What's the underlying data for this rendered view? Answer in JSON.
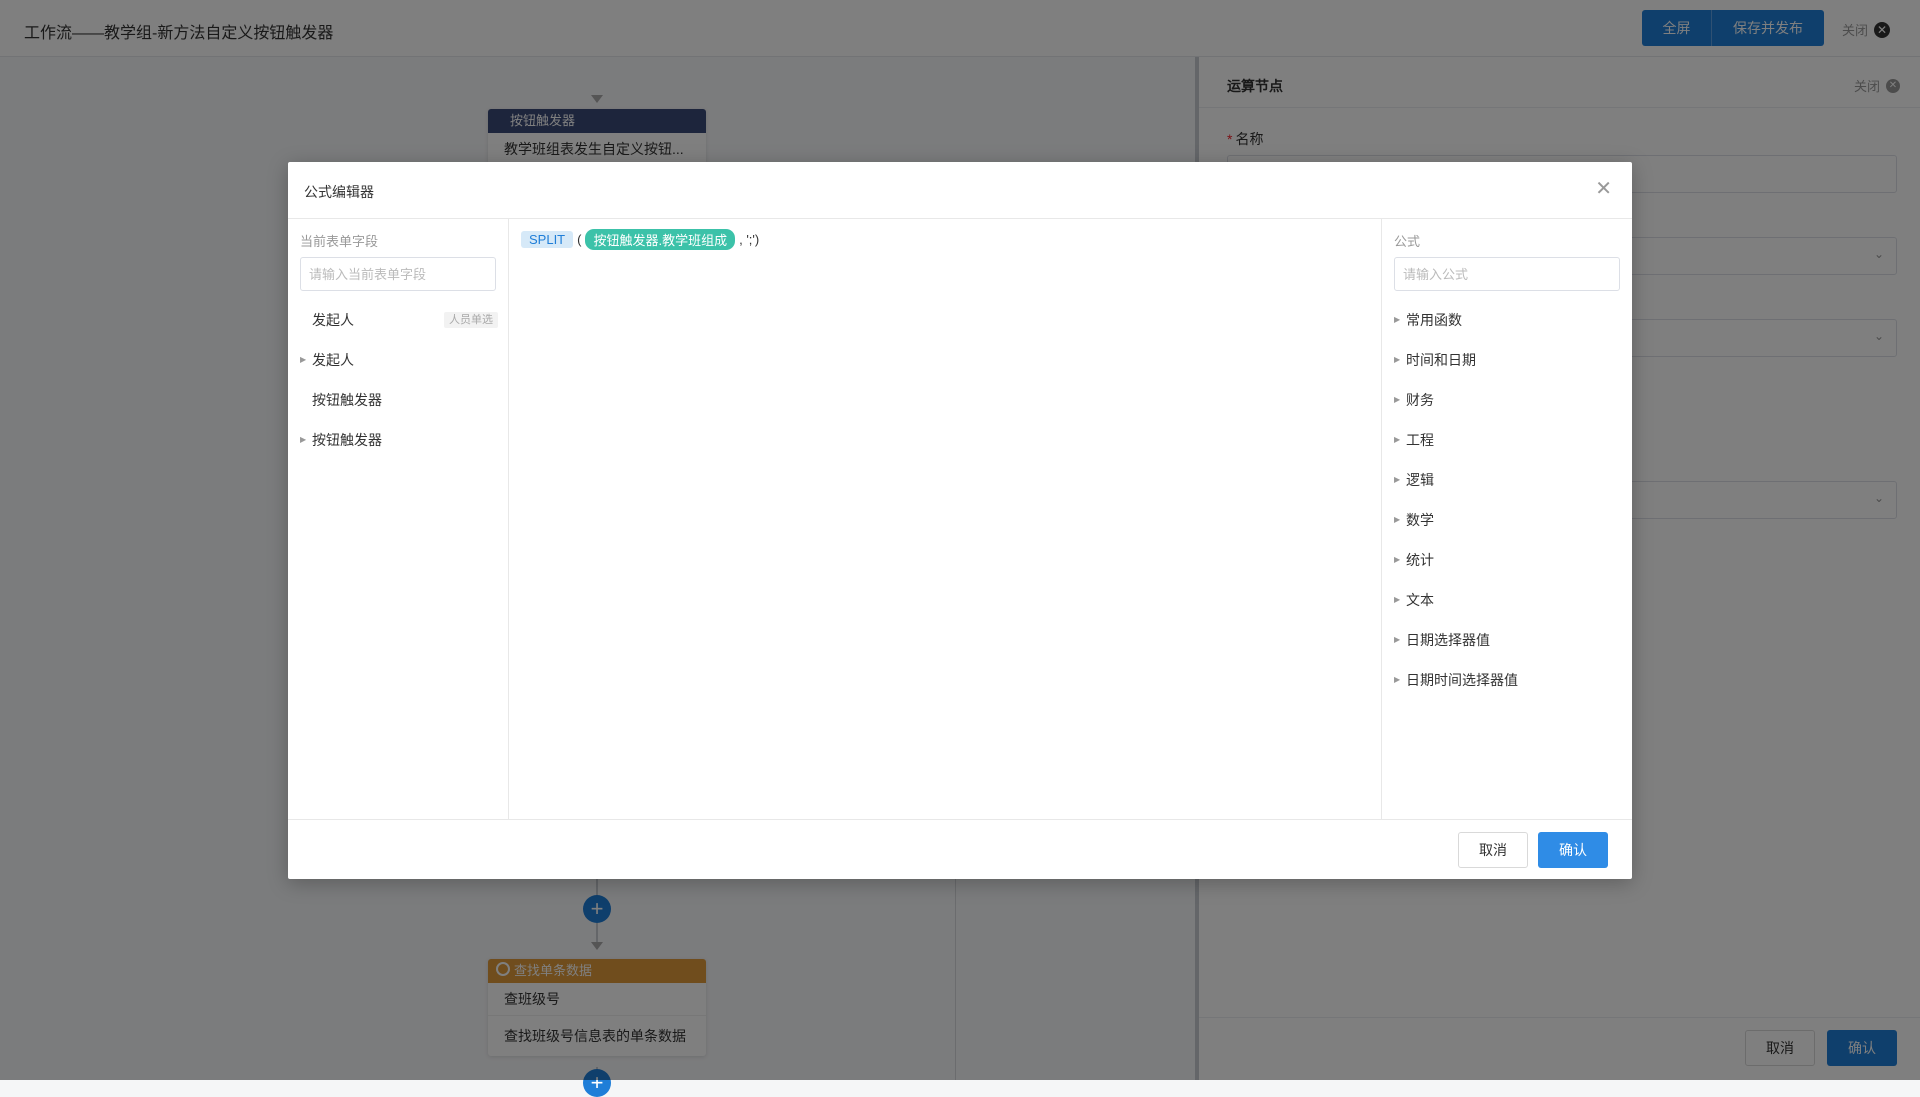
{
  "app": {
    "title": "工作流——教学组-新方法自定义按钮触发器",
    "fullscreen_label": "全屏",
    "save_publish_label": "保存并发布",
    "close_label": "关闭"
  },
  "canvas": {
    "trigger_node": {
      "header": "按钮触发器",
      "body": "教学班组表发生自定义按钮...",
      "color": "#3b4a78"
    },
    "find_node": {
      "header": "查找单条数据",
      "name": "查班级号",
      "desc": "查找班级号信息表的单条数据",
      "color": "#e09a3a"
    }
  },
  "right_panel": {
    "title": "运算节点",
    "close_label": "关闭",
    "name_label": "名称",
    "cancel_label": "取消",
    "confirm_label": "确认"
  },
  "modal": {
    "title": "公式编辑器",
    "left": {
      "label": "当前表单字段",
      "placeholder": "请输入当前表单字段",
      "items": [
        {
          "label": "发起人",
          "tag": "人员单选",
          "expandable": false
        },
        {
          "label": "发起人",
          "tag": "",
          "expandable": true
        },
        {
          "label": "按钮触发器",
          "tag": "",
          "expandable": false
        },
        {
          "label": "按钮触发器",
          "tag": "",
          "expandable": true
        }
      ]
    },
    "formula": {
      "function": "SPLIT",
      "open_paren": "(",
      "field": "按钮触发器.教学班组成",
      "rest": ", ';')"
    },
    "right": {
      "label": "公式",
      "placeholder": "请输入公式",
      "categories": [
        "常用函数",
        "时间和日期",
        "财务",
        "工程",
        "逻辑",
        "数学",
        "统计",
        "文本",
        "日期选择器值",
        "日期时间选择器值"
      ]
    },
    "cancel_label": "取消",
    "confirm_label": "确认"
  },
  "colors": {
    "primary": "#1f7ed8",
    "field_chip": "#3cc2a9",
    "function_chip_bg": "#d6e9f8"
  }
}
